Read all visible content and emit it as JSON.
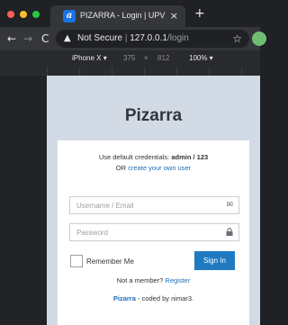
{
  "browser": {
    "tab": {
      "title": "PIZARRA - Login | UPV",
      "favicon": "a",
      "close": "×"
    },
    "new_tab": "+",
    "nav": {
      "back": "←",
      "forward": "→",
      "reload": "C"
    },
    "address": {
      "security_label": "Not Secure",
      "separator": "|",
      "host": "127.0.0.1",
      "path": "/login",
      "warning_icon": "warning-triangle",
      "bookmark_icon": "star"
    },
    "device_toolbar": {
      "device": "iPhone X ▾",
      "width": "375",
      "times": "×",
      "height": "812",
      "zoom": "100% ▾"
    }
  },
  "page": {
    "brand": "Pizarra",
    "credentials_prefix": "Use default credentials:",
    "credentials_value": "admin / 123",
    "create_prefix": "OR",
    "create_link": "create your own user",
    "username_placeholder": "Username / Email",
    "password_placeholder": "Password",
    "remember_label": "Remember Me",
    "signin_label": "Sign In",
    "member_prefix": "Not a member?",
    "register_link": "Register",
    "credit_brand": "Pizarra",
    "credit_suffix": "- coded by nimar3."
  },
  "colors": {
    "accent": "#1f7ac2",
    "link": "#1a6eb5",
    "page_bg": "#d2dbe5",
    "chrome_dark": "#202124"
  }
}
